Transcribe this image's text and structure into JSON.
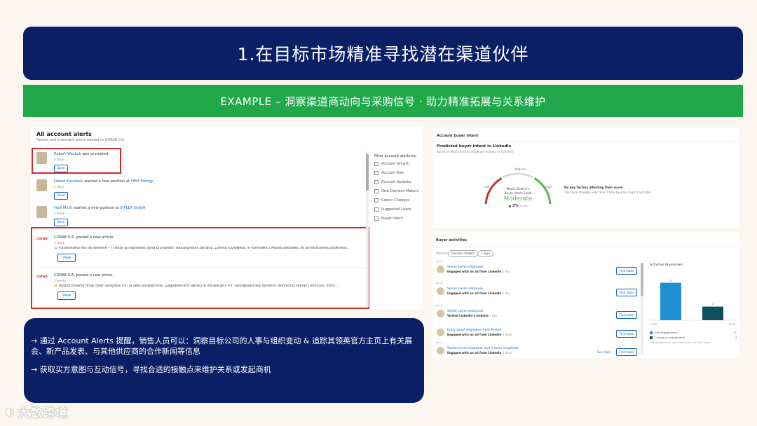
{
  "slide": {
    "title": "1.在目标市场精准寻找潜在渠道伙伴",
    "subtitle": "EXAMPLE – 洞察渠道商动向与采购信号 · 助力精准拓展与关系维护"
  },
  "alerts_panel": {
    "title": "All account alerts",
    "subtitle": "Recent and important alerts related to CORAB S.A.",
    "alerts": [
      {
        "person": "Robert Wasiluk",
        "action": "was promoted",
        "company": "",
        "time": "4 days",
        "button": "Save"
      },
      {
        "person": "Dawid Kuczinski",
        "action": "started a new position at",
        "company": "OEM Energy",
        "time": "1 days",
        "button": "Save"
      },
      {
        "person": "Halil Micik",
        "action": "started a new position at",
        "company": "S-FLEX GmbH",
        "time": "1 week",
        "button": "Save"
      }
    ],
    "posts": [
      {
        "author": "CORAB S.A.",
        "action": "posted a new article.",
        "time": "1 week",
        "body": "😊 Fotowoltaika ma się świetnie – i ciesza ją naprawdę jasna przyszłość! Nasza prezes zarządu, Żaneta Kozłowska, w rozmowie z Maciej Badowski ze Strefa Biznesu podkreśla...",
        "button": "View"
      },
      {
        "author": "CORAB S.A.",
        "action": "posted a new photo.",
        "time": "2 weeks",
        "body": "👉 Rozpoczynamy drugi dzień Kongresu PV! W sesji poświęconej „Zagadnieniom jakości w instalacjach PV\" występuje nasz dyrektor techniczny Adrian Dmirczuk, który...",
        "button": "View"
      }
    ],
    "logo_text": "corab",
    "filter_title": "Filter account alerts by:",
    "filters": [
      "Account Growth",
      "Account Risk",
      "Account Updates",
      "New Decision Makers",
      "Career Changes",
      "Suggested Leads",
      "Buyer Intent"
    ]
  },
  "buyer_intent": {
    "title": "Account buyer intent",
    "subtitle": "Predicted buyer intent in LinkedIn",
    "caption": "Based on Meola Electric employee activity on LinkedIn",
    "gauge_labels": [
      "Low",
      "Medium",
      "High"
    ],
    "gauge_level": 0.55,
    "gauge_name_1": "Meola Electric's",
    "gauge_name_2": "Buyer Intent Scale",
    "gauge_value": "Moderate",
    "gauge_change": "▲ 3%",
    "gauge_change_note": "vs last",
    "no_factors_title": "No key factors affecting their score",
    "no_factors_text": "The score changes over time. Come back to check it out later.",
    "colors": {
      "low": "#c0392b",
      "medium": "#d9d9d9",
      "high": "#5bb05b"
    }
  },
  "buyer_activities": {
    "title": "Buyer activities",
    "show_label": "Show by",
    "chips": [
      "Decision makers",
      "7 days"
    ],
    "rows": [
      {
        "date": "Jan 8",
        "title": "Senior Level employee",
        "desc": "Engaged with an ad from LinkedIn",
        "ago": "1 day",
        "button": "Find leads",
        "see_more": ""
      },
      {
        "date": "Jan 8",
        "title": "Senior Level employee",
        "desc": "Engaged with an ad from LinkedIn",
        "ago": "1 day",
        "button": "Find leads",
        "see_more": ""
      },
      {
        "date": "Jan 6",
        "title": "Senior Level employee",
        "desc": "Visited LinkedIn's website",
        "ago": "1 day",
        "button": "Find leads",
        "see_more": ""
      },
      {
        "date": "",
        "title": "Entry Level employee from Poland",
        "desc": "Engaged with an ad from LinkedIn",
        "ago": "3 days",
        "button": "Find leads",
        "see_more": ""
      },
      {
        "date": "Jan 5",
        "title": "Senior Level employee and 1 more employee",
        "desc": "Engaged with an ad from LinkedIn",
        "ago": "4 days",
        "button": "Find leads",
        "see_more": "See more"
      }
    ],
    "breakdown_title": "Activities Breakdown",
    "breakdown_note": "* All engagement calculated from the last 7 days",
    "chart_data": {
      "type": "bar",
      "categories": [
        "Ads engagement",
        "Company engagement"
      ],
      "values": [
        11,
        4
      ],
      "x_labels": [
        "11/09",
        "12/09"
      ],
      "ylim": [
        0,
        14
      ],
      "colors": [
        "#1f8fd1",
        "#0d4f5c"
      ]
    },
    "legend": [
      {
        "label": "Ads engagement",
        "value": "11",
        "color": "#1f8fd1"
      },
      {
        "label": "Company engagement",
        "value": "4",
        "color": "#0d4f5c"
      }
    ]
  },
  "info": {
    "point1": "→ 通过 Account Alerts 提醒，销售人员可以：洞察目标公司的人事与组织变动 & 追踪其领英官方主页上有关展会、新产品发表、与其他供应商的合作新闻等信息",
    "point2": "→ 获取买方意图与互动信号，寻找合适的接触点来维护关系或发起商机"
  },
  "watermark": "大数跨境"
}
